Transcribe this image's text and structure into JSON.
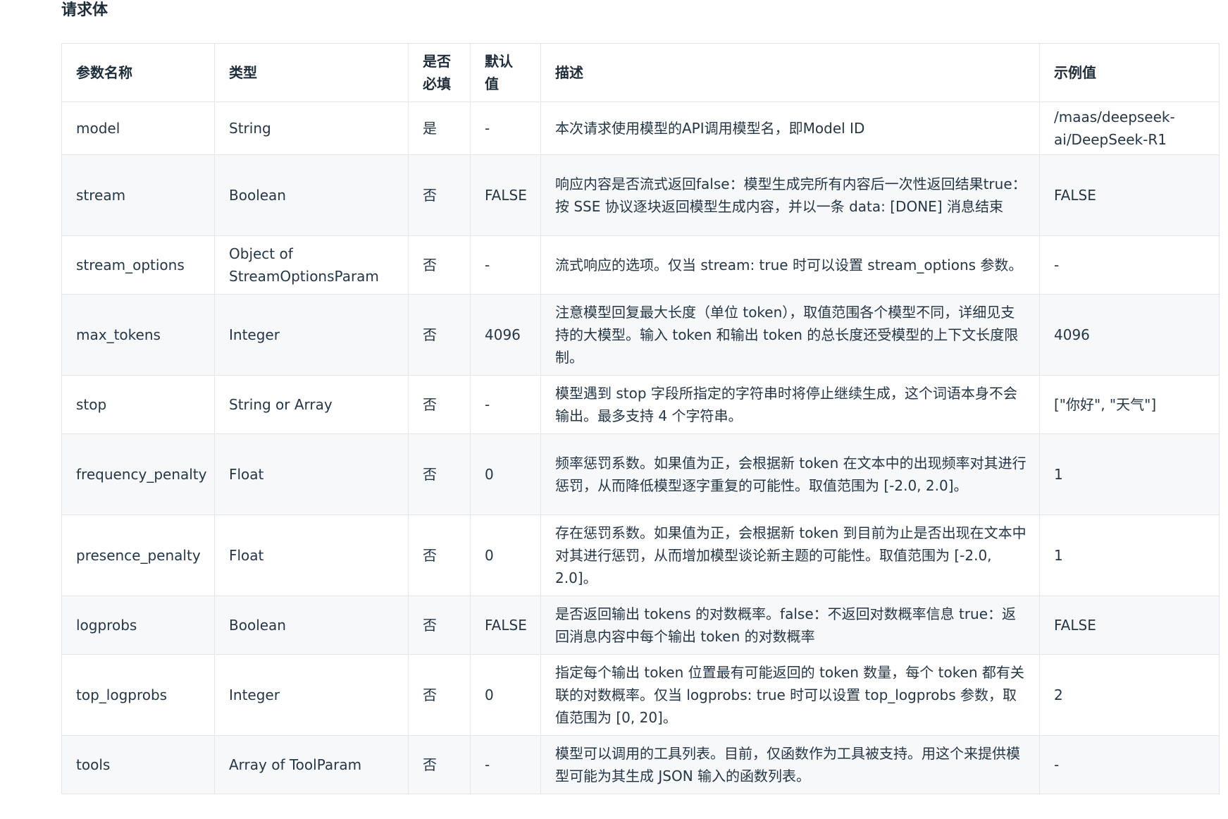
{
  "section": {
    "title": "请求体"
  },
  "table": {
    "headers": {
      "name": "参数名称",
      "type": "类型",
      "required": "是否必填",
      "default": "默认值",
      "description": "描述",
      "example": "示例值"
    },
    "rows": [
      {
        "name": "model",
        "type": "String",
        "required": "是",
        "default": "-",
        "description": "本次请求使用模型的API调用模型名，即Model ID",
        "example": "/maas/deepseek-ai/DeepSeek-R1"
      },
      {
        "name": "stream",
        "type": "Boolean",
        "required": "否",
        "default": "FALSE",
        "description": "响应内容是否流式返回false：模型生成完所有内容后一次性返回结果true：按 SSE 协议逐块返回模型生成内容，并以一条 data: [DONE] 消息结束",
        "example": "FALSE"
      },
      {
        "name": "stream_options",
        "type": "Object of StreamOptionsParam",
        "required": "否",
        "default": "-",
        "description": "流式响应的选项。仅当 stream: true 时可以设置 stream_options 参数。",
        "example": "-"
      },
      {
        "name": "max_tokens",
        "type": "Integer",
        "required": "否",
        "default": "4096",
        "description": "注意模型回复最大长度（单位 token），取值范围各个模型不同，详细见支持的大模型。输入 token 和输出 token 的总长度还受模型的上下文长度限制。",
        "example": "4096"
      },
      {
        "name": "stop",
        "type": "String or Array",
        "required": "否",
        "default": "-",
        "description": "模型遇到 stop 字段所指定的字符串时将停止继续生成，这个词语本身不会输出。最多支持 4 个字符串。",
        "example": "[\"你好\", \"天气\"]"
      },
      {
        "name": "frequency_penalty",
        "type": "Float",
        "required": "否",
        "default": "0",
        "description": "频率惩罚系数。如果值为正，会根据新 token 在文本中的出现频率对其进行惩罚，从而降低模型逐字重复的可能性。取值范围为 [-2.0, 2.0]。",
        "example": "1"
      },
      {
        "name": "presence_penalty",
        "type": "Float",
        "required": "否",
        "default": "0",
        "description": "存在惩罚系数。如果值为正，会根据新 token 到目前为止是否出现在文本中对其进行惩罚，从而增加模型谈论新主题的可能性。取值范围为 [-2.0, 2.0]。",
        "example": "1"
      },
      {
        "name": "logprobs",
        "type": "Boolean",
        "required": "否",
        "default": "FALSE",
        "description": "是否返回输出 tokens 的对数概率。false：不返回对数概率信息 true：返回消息内容中每个输出 token 的对数概率",
        "example": "FALSE"
      },
      {
        "name": "top_logprobs",
        "type": "Integer",
        "required": "否",
        "default": "0",
        "description": "指定每个输出 token 位置最有可能返回的 token 数量，每个 token 都有关联的对数概率。仅当 logprobs: true 时可以设置 top_logprobs 参数，取值范围为 [0, 20]。",
        "example": "2"
      },
      {
        "name": "tools",
        "type": "Array of ToolParam",
        "required": "否",
        "default": "-",
        "description": "模型可以调用的工具列表。目前，仅函数作为工具被支持。用这个来提供模型可能为其生成 JSON 输入的函数列表。",
        "example": "-"
      }
    ]
  }
}
